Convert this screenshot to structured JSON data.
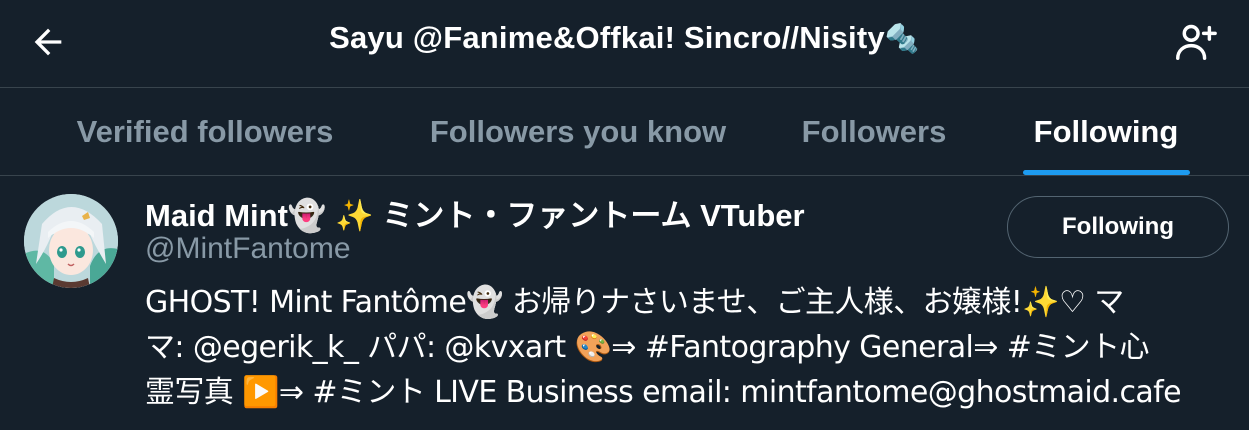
{
  "header": {
    "title": "Sayu @Fanime&Offkai! Sincro//Nisity",
    "title_emoji": "🔩",
    "back_icon": "arrow-left-icon",
    "add_user_icon": "person-add-icon"
  },
  "tabs": [
    {
      "label": "Verified followers",
      "active": false
    },
    {
      "label": "Followers you know",
      "active": false
    },
    {
      "label": "Followers",
      "active": false
    },
    {
      "label": "Following",
      "active": true
    }
  ],
  "colors": {
    "background": "#15202b",
    "accent": "#1d9bf0",
    "muted_text": "#8899a6",
    "divider": "#38444d"
  },
  "user": {
    "name_start": "Maid Mint",
    "name_emoji_ghost": "👻",
    "name_emoji_sparkles": "✨",
    "name_end": "ミント・ファントーム VTuber",
    "handle": "@MintFantome",
    "follow_button_label": "Following",
    "bio": {
      "l1_a": "GHOST! Mint Fantôme",
      "l1_ghost": "👻",
      "l1_b": " お帰りナさいませ、ご主人様、お嬢様!",
      "l1_sparkles": "✨",
      "l1_c": "♡ マ",
      "l2_a": "マ: ",
      "l2_mention1": "@egerik_k_",
      "l2_b": " パパ: ",
      "l2_mention2": "@kvxart",
      "l2_palette": "🎨",
      "l2_c": "⇒ ",
      "l2_hashtag1": "#Fantography General",
      "l2_d": "⇒ ",
      "l2_hashtag2": "#ミント心",
      "l3_a": "霊写真 ",
      "l3_play": "▶️",
      "l3_b": "⇒ ",
      "l3_hashtag3": "#ミント LIVE",
      "l3_c": " Business email: mintfantome@ghostmaid.cafe"
    }
  }
}
